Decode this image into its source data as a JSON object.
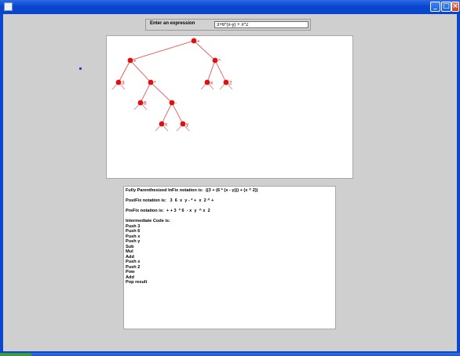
{
  "window": {
    "title": "",
    "controls": [
      "minimize-icon",
      "maximize-icon",
      "close-icon"
    ]
  },
  "input": {
    "label": "Enter an expression",
    "value": "3+6*(x-y) + x^2"
  },
  "tree": {
    "nodes": [
      {
        "id": "root",
        "label": "+"
      },
      {
        "id": "n_left_plus",
        "label": "+"
      },
      {
        "id": "n_pow",
        "label": "^"
      },
      {
        "id": "n_3",
        "label": "3"
      },
      {
        "id": "n_mul",
        "label": "*"
      },
      {
        "id": "n_x1",
        "label": "x"
      },
      {
        "id": "n_2",
        "label": "2"
      },
      {
        "id": "n_6",
        "label": "6"
      },
      {
        "id": "n_minus",
        "label": "-"
      },
      {
        "id": "n_x2",
        "label": "x"
      },
      {
        "id": "n_y",
        "label": "y"
      }
    ],
    "edges": [
      [
        "root",
        "n_left_plus"
      ],
      [
        "root",
        "n_pow"
      ],
      [
        "n_left_plus",
        "n_3"
      ],
      [
        "n_left_plus",
        "n_mul"
      ],
      [
        "n_pow",
        "n_x1"
      ],
      [
        "n_pow",
        "n_2"
      ],
      [
        "n_mul",
        "n_6"
      ],
      [
        "n_mul",
        "n_minus"
      ],
      [
        "n_minus",
        "n_x2"
      ],
      [
        "n_minus",
        "n_y"
      ]
    ],
    "colors": {
      "node": "#e01010",
      "edge": "#e04040",
      "leaf_stub": "#d07070",
      "label": "#e01010"
    }
  },
  "output": {
    "lines": [
      "Fully Parenthesized InFix notation is:  ((3 + (6 * (x - y))) + (x ^ 2))",
      "",
      "PostFix notation is:   3  6  x  y - * +  x  2 ^ +",
      "",
      "PreFix notation is:  + + 3  * 6  - x  y  ^ x  2",
      "",
      "Intermediate Code is:",
      "Push 3",
      "Push 6",
      "Push x",
      "Push y",
      "Sub",
      "Mul",
      "Add",
      "Push x",
      "Push 2",
      "Pow",
      "Add",
      "Pop result"
    ]
  }
}
